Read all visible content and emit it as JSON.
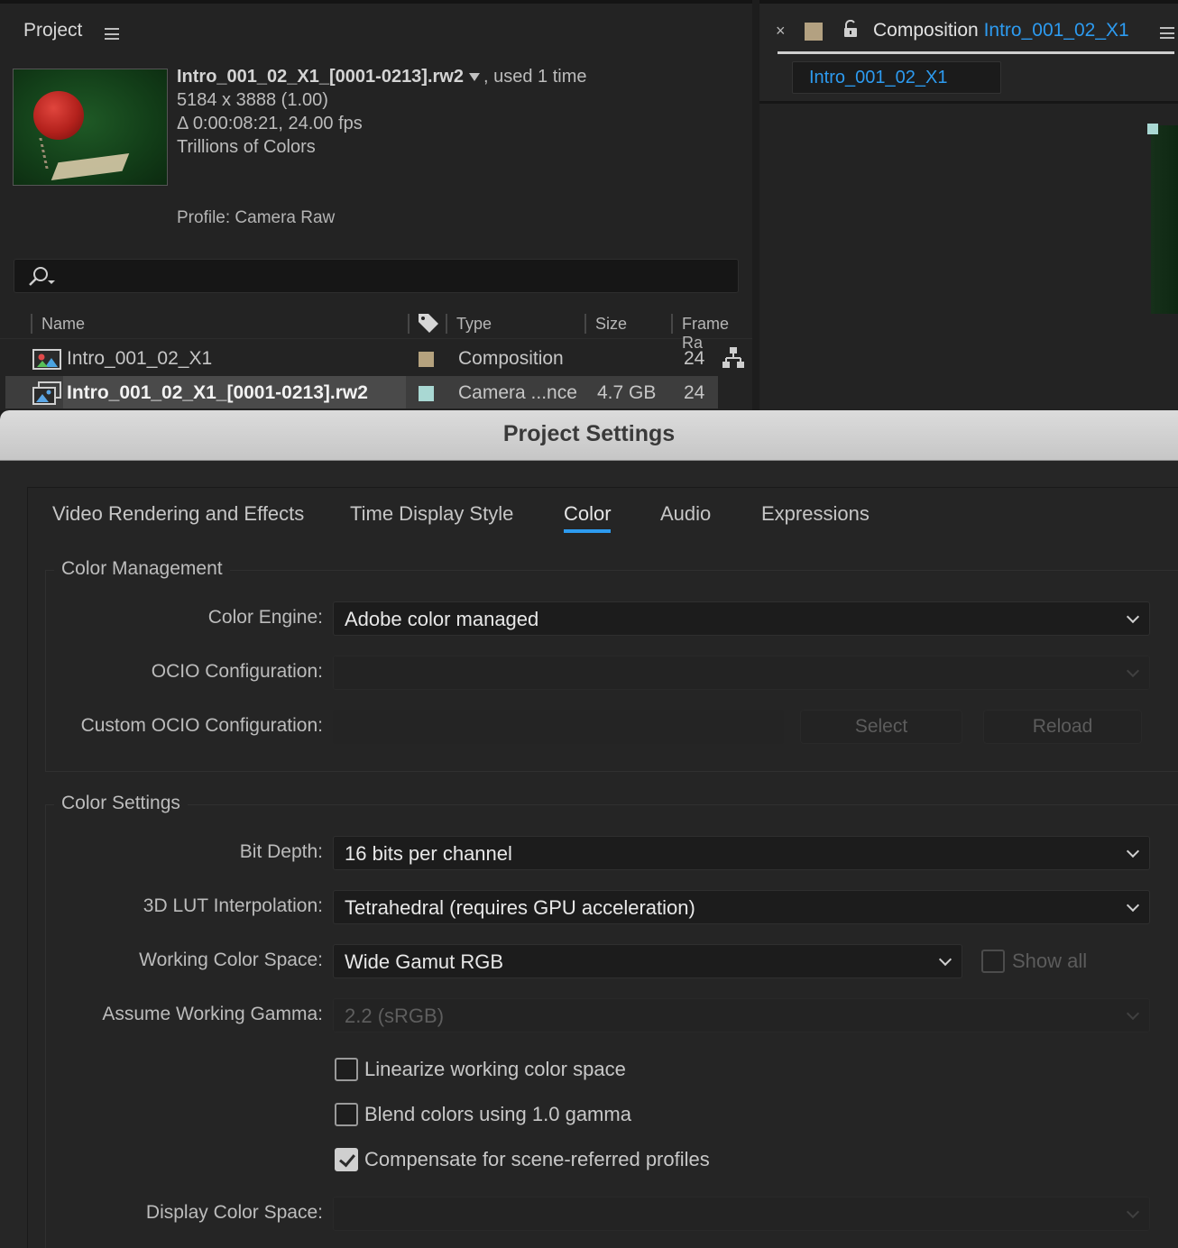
{
  "project_panel": {
    "title": "Project",
    "footage": {
      "filename": "Intro_001_02_X1_[0001-0213].rw2",
      "usage": ", used 1 time",
      "dimensions": "5184 x 3888 (1.00)",
      "duration": "Δ 0:00:08:21, 24.00 fps",
      "colors": "Trillions of Colors",
      "profile": "Profile: Camera Raw"
    },
    "columns": {
      "name": "Name",
      "type": "Type",
      "size": "Size",
      "frame_rate": "Frame Ra"
    },
    "items": [
      {
        "name": "Intro_001_02_X1",
        "type": "Composition",
        "size": "",
        "frame_rate": "24",
        "label_color": "#b5a27e"
      },
      {
        "name": "Intro_001_02_X1_[0001-0213].rw2",
        "type": "Camera ...nce",
        "size": "4.7 GB",
        "frame_rate": "24",
        "label_color": "#a9d8d3"
      }
    ]
  },
  "comp_panel": {
    "close": "×",
    "title_prefix": "Composition",
    "comp_name": "Intro_001_02_X1",
    "tab_label": "Intro_001_02_X1",
    "accent": "#2d9bf0"
  },
  "dialog": {
    "title": "Project Settings",
    "tabs": [
      "Video Rendering and Effects",
      "Time Display Style",
      "Color",
      "Audio",
      "Expressions"
    ],
    "active_tab": "Color",
    "color_management": {
      "title": "Color Management",
      "engine_label": "Color Engine:",
      "engine_value": "Adobe color managed",
      "ocio_label": "OCIO Configuration:",
      "custom_ocio_label": "Custom OCIO Configuration:",
      "select_button": "Select",
      "reload_button": "Reload"
    },
    "color_settings": {
      "title": "Color Settings",
      "bit_depth_label": "Bit Depth:",
      "bit_depth_value": "16 bits per channel",
      "lut_label": "3D LUT Interpolation:",
      "lut_value": "Tetrahedral (requires GPU acceleration)",
      "working_space_label": "Working Color Space:",
      "working_space_value": "Wide Gamut RGB",
      "show_all_label": "Show all",
      "gamma_label": "Assume Working Gamma:",
      "gamma_value": "2.2 (sRGB)",
      "linearize_label": "Linearize working color space",
      "linearize_checked": false,
      "blend_label": "Blend colors using 1.0 gamma",
      "blend_checked": false,
      "compensate_label": "Compensate for scene-referred profiles",
      "compensate_checked": true,
      "display_space_label": "Display Color Space:"
    }
  }
}
